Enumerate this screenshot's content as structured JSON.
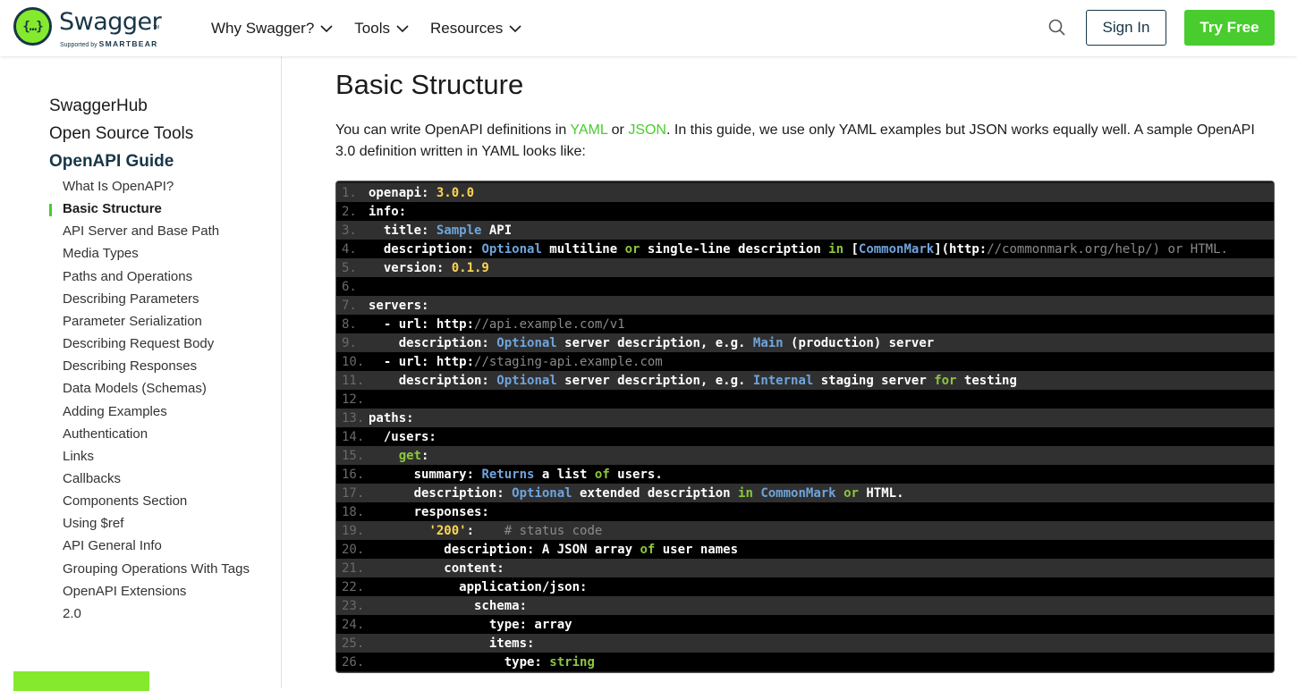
{
  "header": {
    "logo": {
      "badge": "{…}",
      "name": "Swagger",
      "tm": "TM",
      "sub_prefix": "Supported by",
      "sub_brand": "SMARTBEAR"
    },
    "nav": [
      {
        "label": "Why Swagger?"
      },
      {
        "label": "Tools"
      },
      {
        "label": "Resources"
      }
    ],
    "sign_in": "Sign In",
    "try_free": "Try Free"
  },
  "sidebar": {
    "top_items": [
      {
        "label": "SwaggerHub"
      },
      {
        "label": "Open Source Tools"
      },
      {
        "label": "OpenAPI Guide"
      }
    ],
    "guide_items": [
      {
        "label": "What Is OpenAPI?"
      },
      {
        "label": "Basic Structure"
      },
      {
        "label": "API Server and Base Path"
      },
      {
        "label": "Media Types"
      },
      {
        "label": "Paths and Operations"
      },
      {
        "label": "Describing Parameters"
      },
      {
        "label": "Parameter Serialization"
      },
      {
        "label": "Describing Request Body"
      },
      {
        "label": "Describing Responses"
      },
      {
        "label": "Data Models (Schemas)"
      },
      {
        "label": "Adding Examples"
      },
      {
        "label": "Authentication"
      },
      {
        "label": "Links"
      },
      {
        "label": "Callbacks"
      },
      {
        "label": "Components Section"
      },
      {
        "label": "Using $ref"
      },
      {
        "label": "API General Info"
      },
      {
        "label": "Grouping Operations With Tags"
      },
      {
        "label": "OpenAPI Extensions"
      },
      {
        "label": "2.0"
      }
    ],
    "active_index": 1
  },
  "main": {
    "title": "Basic Structure",
    "intro": {
      "t1": "You can write OpenAPI definitions in ",
      "link1": "YAML",
      "t2": " or ",
      "link2": "JSON",
      "t3": ". In this guide, we use only YAML examples but JSON works equally well. A sample OpenAPI 3.0 definition written in YAML looks like:"
    },
    "code_lines": [
      [
        [
          "openapi: ",
          "w"
        ],
        [
          "3.0.0",
          "n"
        ]
      ],
      [
        [
          "info:",
          "w"
        ]
      ],
      [
        [
          "  title: ",
          "w"
        ],
        [
          "Sample",
          "b"
        ],
        [
          " API",
          "w"
        ]
      ],
      [
        [
          "  description: ",
          "w"
        ],
        [
          "Optional",
          "b"
        ],
        [
          " multiline ",
          "w"
        ],
        [
          "or",
          "g"
        ],
        [
          " single-line description ",
          "w"
        ],
        [
          "in",
          "g"
        ],
        [
          " [",
          "w"
        ],
        [
          "CommonMark",
          "b"
        ],
        [
          "](http:",
          "w"
        ],
        [
          "//commonmark.org/help/) or HTML.",
          "c"
        ]
      ],
      [
        [
          "  version: ",
          "w"
        ],
        [
          "0.1.9",
          "n"
        ]
      ],
      [
        [
          "",
          "w"
        ]
      ],
      [
        [
          "servers:",
          "w"
        ]
      ],
      [
        [
          "  - url: http:",
          "w"
        ],
        [
          "//api.example.com/v1",
          "c"
        ]
      ],
      [
        [
          "    description: ",
          "w"
        ],
        [
          "Optional",
          "b"
        ],
        [
          " server description, e.g. ",
          "w"
        ],
        [
          "Main",
          "b"
        ],
        [
          " (production) server",
          "w"
        ]
      ],
      [
        [
          "  - url: http:",
          "w"
        ],
        [
          "//staging-api.example.com",
          "c"
        ]
      ],
      [
        [
          "    description: ",
          "w"
        ],
        [
          "Optional",
          "b"
        ],
        [
          " server description, e.g. ",
          "w"
        ],
        [
          "Internal",
          "b"
        ],
        [
          " staging server ",
          "w"
        ],
        [
          "for",
          "g"
        ],
        [
          " testing",
          "w"
        ]
      ],
      [
        [
          "",
          "w"
        ]
      ],
      [
        [
          "paths:",
          "w"
        ]
      ],
      [
        [
          "  /users:",
          "w"
        ]
      ],
      [
        [
          "    ",
          "w"
        ],
        [
          "get",
          "g"
        ],
        [
          ":",
          "w"
        ]
      ],
      [
        [
          "      summary: ",
          "w"
        ],
        [
          "Returns",
          "b"
        ],
        [
          " a list ",
          "w"
        ],
        [
          "of",
          "g"
        ],
        [
          " users.",
          "w"
        ]
      ],
      [
        [
          "      description: ",
          "w"
        ],
        [
          "Optional",
          "b"
        ],
        [
          " extended description ",
          "w"
        ],
        [
          "in",
          "g"
        ],
        [
          " ",
          "w"
        ],
        [
          "CommonMark",
          "b"
        ],
        [
          " ",
          "w"
        ],
        [
          "or",
          "g"
        ],
        [
          " HTML.",
          "w"
        ]
      ],
      [
        [
          "      responses:",
          "w"
        ]
      ],
      [
        [
          "        ",
          "w"
        ],
        [
          "'200'",
          "n"
        ],
        [
          ":    ",
          "w"
        ],
        [
          "# status code",
          "c"
        ]
      ],
      [
        [
          "          description: A JSON array ",
          "w"
        ],
        [
          "of",
          "g"
        ],
        [
          " user names",
          "w"
        ]
      ],
      [
        [
          "          content:",
          "w"
        ]
      ],
      [
        [
          "            application/json:",
          "w"
        ]
      ],
      [
        [
          "              schema:",
          "w"
        ]
      ],
      [
        [
          "                type: array",
          "w"
        ]
      ],
      [
        [
          "                items:",
          "w"
        ]
      ],
      [
        [
          "                  type: ",
          "w"
        ],
        [
          "string",
          "g"
        ]
      ]
    ],
    "code_colors": {
      "w": "#ffffff",
      "n": "#ffd54f",
      "b": "#6fa4dc",
      "g": "#8dc63f",
      "c": "#8a8a8a"
    }
  }
}
